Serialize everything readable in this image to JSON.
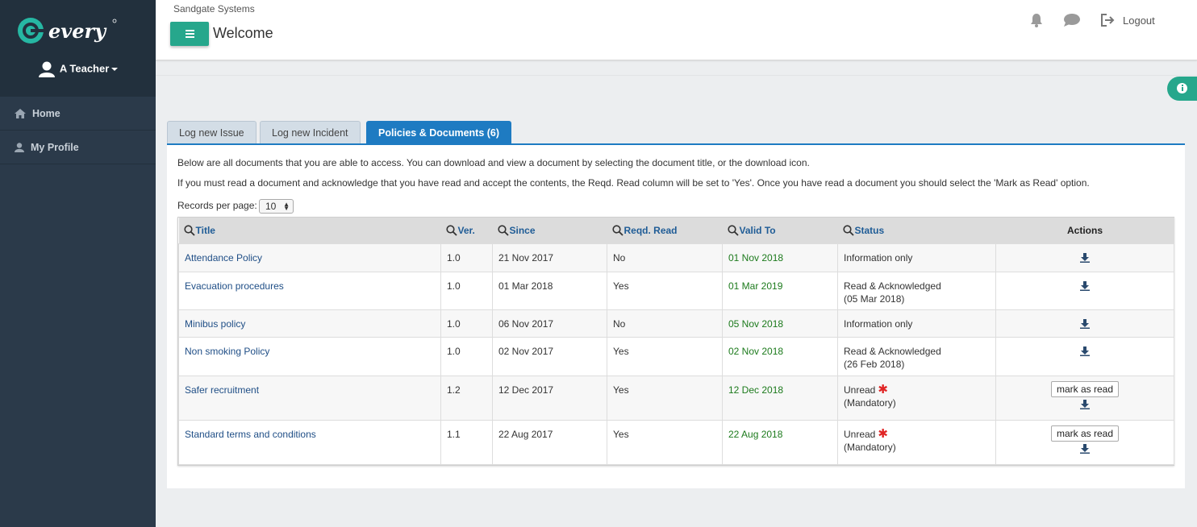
{
  "sidebar": {
    "brand": "every",
    "user_name": "A Teacher",
    "items": [
      {
        "label": "Home",
        "icon": "home-icon"
      },
      {
        "label": "My Profile",
        "icon": "user-icon"
      }
    ]
  },
  "header": {
    "company": "Sandgate Systems",
    "title": "Welcome",
    "logout_label": "Logout"
  },
  "tabs": [
    {
      "label": "Log new Issue",
      "active": false
    },
    {
      "label": "Log new Incident",
      "active": false
    },
    {
      "label": "Policies & Documents (6)",
      "active": true
    }
  ],
  "content": {
    "intro1": "Below are all documents that you are able to access. You can download and view a document by selecting the document title, or the download icon.",
    "intro2": "If you must read a document and acknowledge that you have read and accept the contents, the Reqd. Read column will be set to 'Yes'. Once you have read a document you should select the 'Mark as Read' option.",
    "records_label": "Records per page:",
    "records_value": "10"
  },
  "table": {
    "headers": {
      "title": "Title",
      "ver": "Ver.",
      "since": "Since",
      "reqd": "Reqd. Read",
      "valid": "Valid To",
      "status": "Status",
      "actions": "Actions"
    },
    "mark_label": "mark as read",
    "rows": [
      {
        "title": "Attendance Policy",
        "ver": "1.0",
        "since": "21 Nov 2017",
        "reqd": "No",
        "valid": "01 Nov 2018",
        "status": "Information only",
        "status2": "",
        "mark": false
      },
      {
        "title": "Evacuation procedures",
        "ver": "1.0",
        "since": "01 Mar 2018",
        "reqd": "Yes",
        "valid": "01 Mar 2019",
        "status": "Read & Acknowledged",
        "status2": "(05 Mar 2018)",
        "mark": false
      },
      {
        "title": "Minibus policy",
        "ver": "1.0",
        "since": "06 Nov 2017",
        "reqd": "No",
        "valid": "05 Nov 2018",
        "status": "Information only",
        "status2": "",
        "mark": false
      },
      {
        "title": "Non smoking Policy",
        "ver": "1.0",
        "since": "02 Nov 2017",
        "reqd": "Yes",
        "valid": "02 Nov 2018",
        "status": "Read & Acknowledged",
        "status2": "(26 Feb 2018)",
        "mark": false
      },
      {
        "title": "Safer recruitment",
        "ver": "1.2",
        "since": "12 Dec 2017",
        "reqd": "Yes",
        "valid": "12 Dec 2018",
        "status": "Unread",
        "status2": "(Mandatory)",
        "mark": true
      },
      {
        "title": "Standard terms and conditions",
        "ver": "1.1",
        "since": "22 Aug 2017",
        "reqd": "Yes",
        "valid": "22 Aug 2018",
        "status": "Unread",
        "status2": "(Mandatory)",
        "mark": true
      }
    ]
  },
  "colors": {
    "accent": "#26a78c",
    "tab_active": "#1e7bc2",
    "sidebar": "#2b3a4a",
    "link": "#1f4e86",
    "valid_date": "#1c7a1c",
    "mandatory_star": "#e02424"
  }
}
